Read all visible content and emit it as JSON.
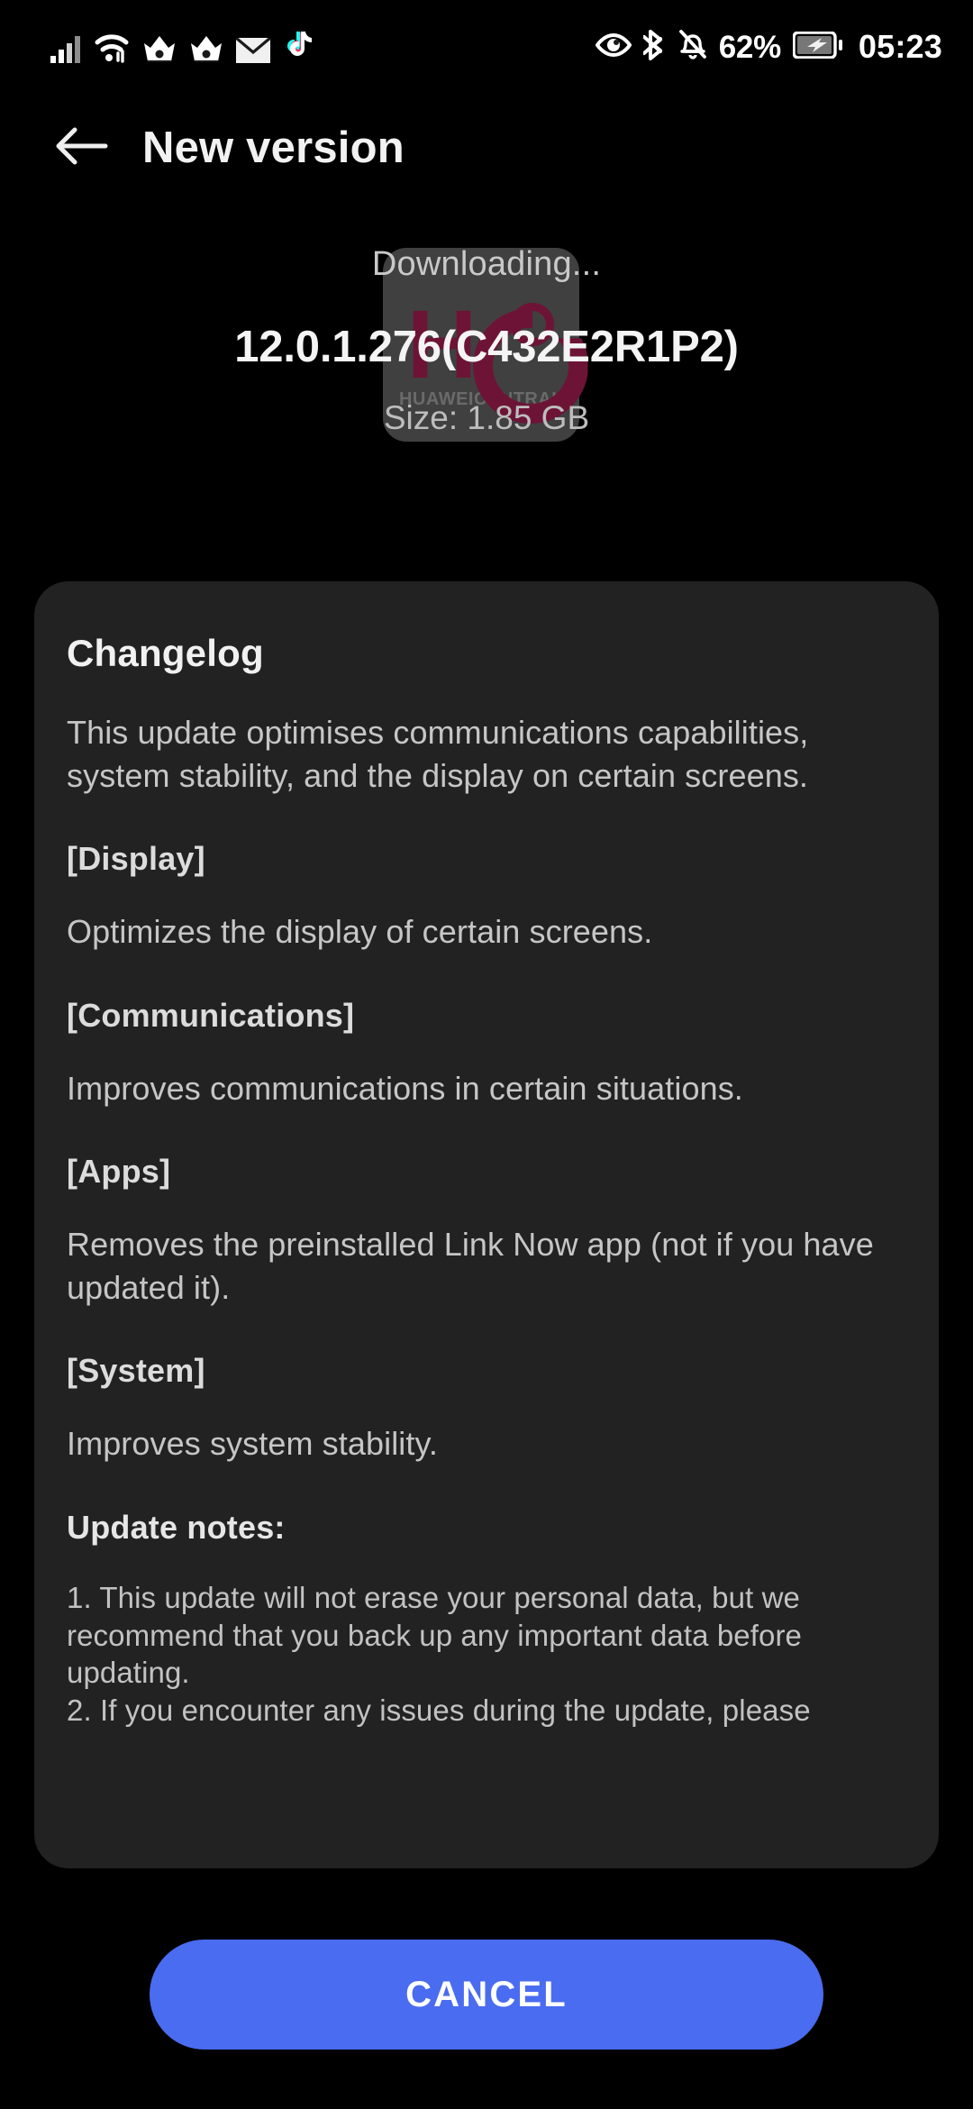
{
  "status_bar": {
    "left_icons": [
      "signal-bars-icon",
      "wifi-icon",
      "crown-app-icon",
      "crown-app-icon",
      "mail-icon",
      "tiktok-icon"
    ],
    "right_icons": [
      "eye-comfort-icon",
      "bluetooth-icon",
      "mute-bell-icon",
      "battery-charging-icon"
    ],
    "battery_percent": "62%",
    "clock": "05:23"
  },
  "header": {
    "back_icon": "arrow-left-icon",
    "title": "New version"
  },
  "download": {
    "status": "Downloading...",
    "version": "12.0.1.276(C432E2R1P2)",
    "size": "Size: 1.85 GB"
  },
  "watermark": {
    "logo_h": "H",
    "subtitle": "HUAWEICENTRAL"
  },
  "changelog": {
    "title": "Changelog",
    "intro": "This update optimises communications capabilities, system stability, and the display on certain screens.",
    "sections": [
      {
        "head": "[Display]",
        "body": "Optimizes the display of certain screens."
      },
      {
        "head": "[Communications]",
        "body": "Improves communications in certain situations."
      },
      {
        "head": "[Apps]",
        "body": "Removes the preinstalled Link Now app (not if you have updated it)."
      },
      {
        "head": "[System]",
        "body": "Improves system stability."
      }
    ],
    "notes_head": "Update notes:",
    "notes": [
      "1. This update will not erase your personal data, but we recommend that you back up any important data before updating.",
      "2. If you encounter any issues during the update, please"
    ]
  },
  "actions": {
    "cancel_label": "CANCEL"
  },
  "colors": {
    "background": "#000000",
    "card": "#222222",
    "accent": "#4a6cf0",
    "watermark_logo": "#6d1436",
    "body_text": "#c6c6c6"
  }
}
